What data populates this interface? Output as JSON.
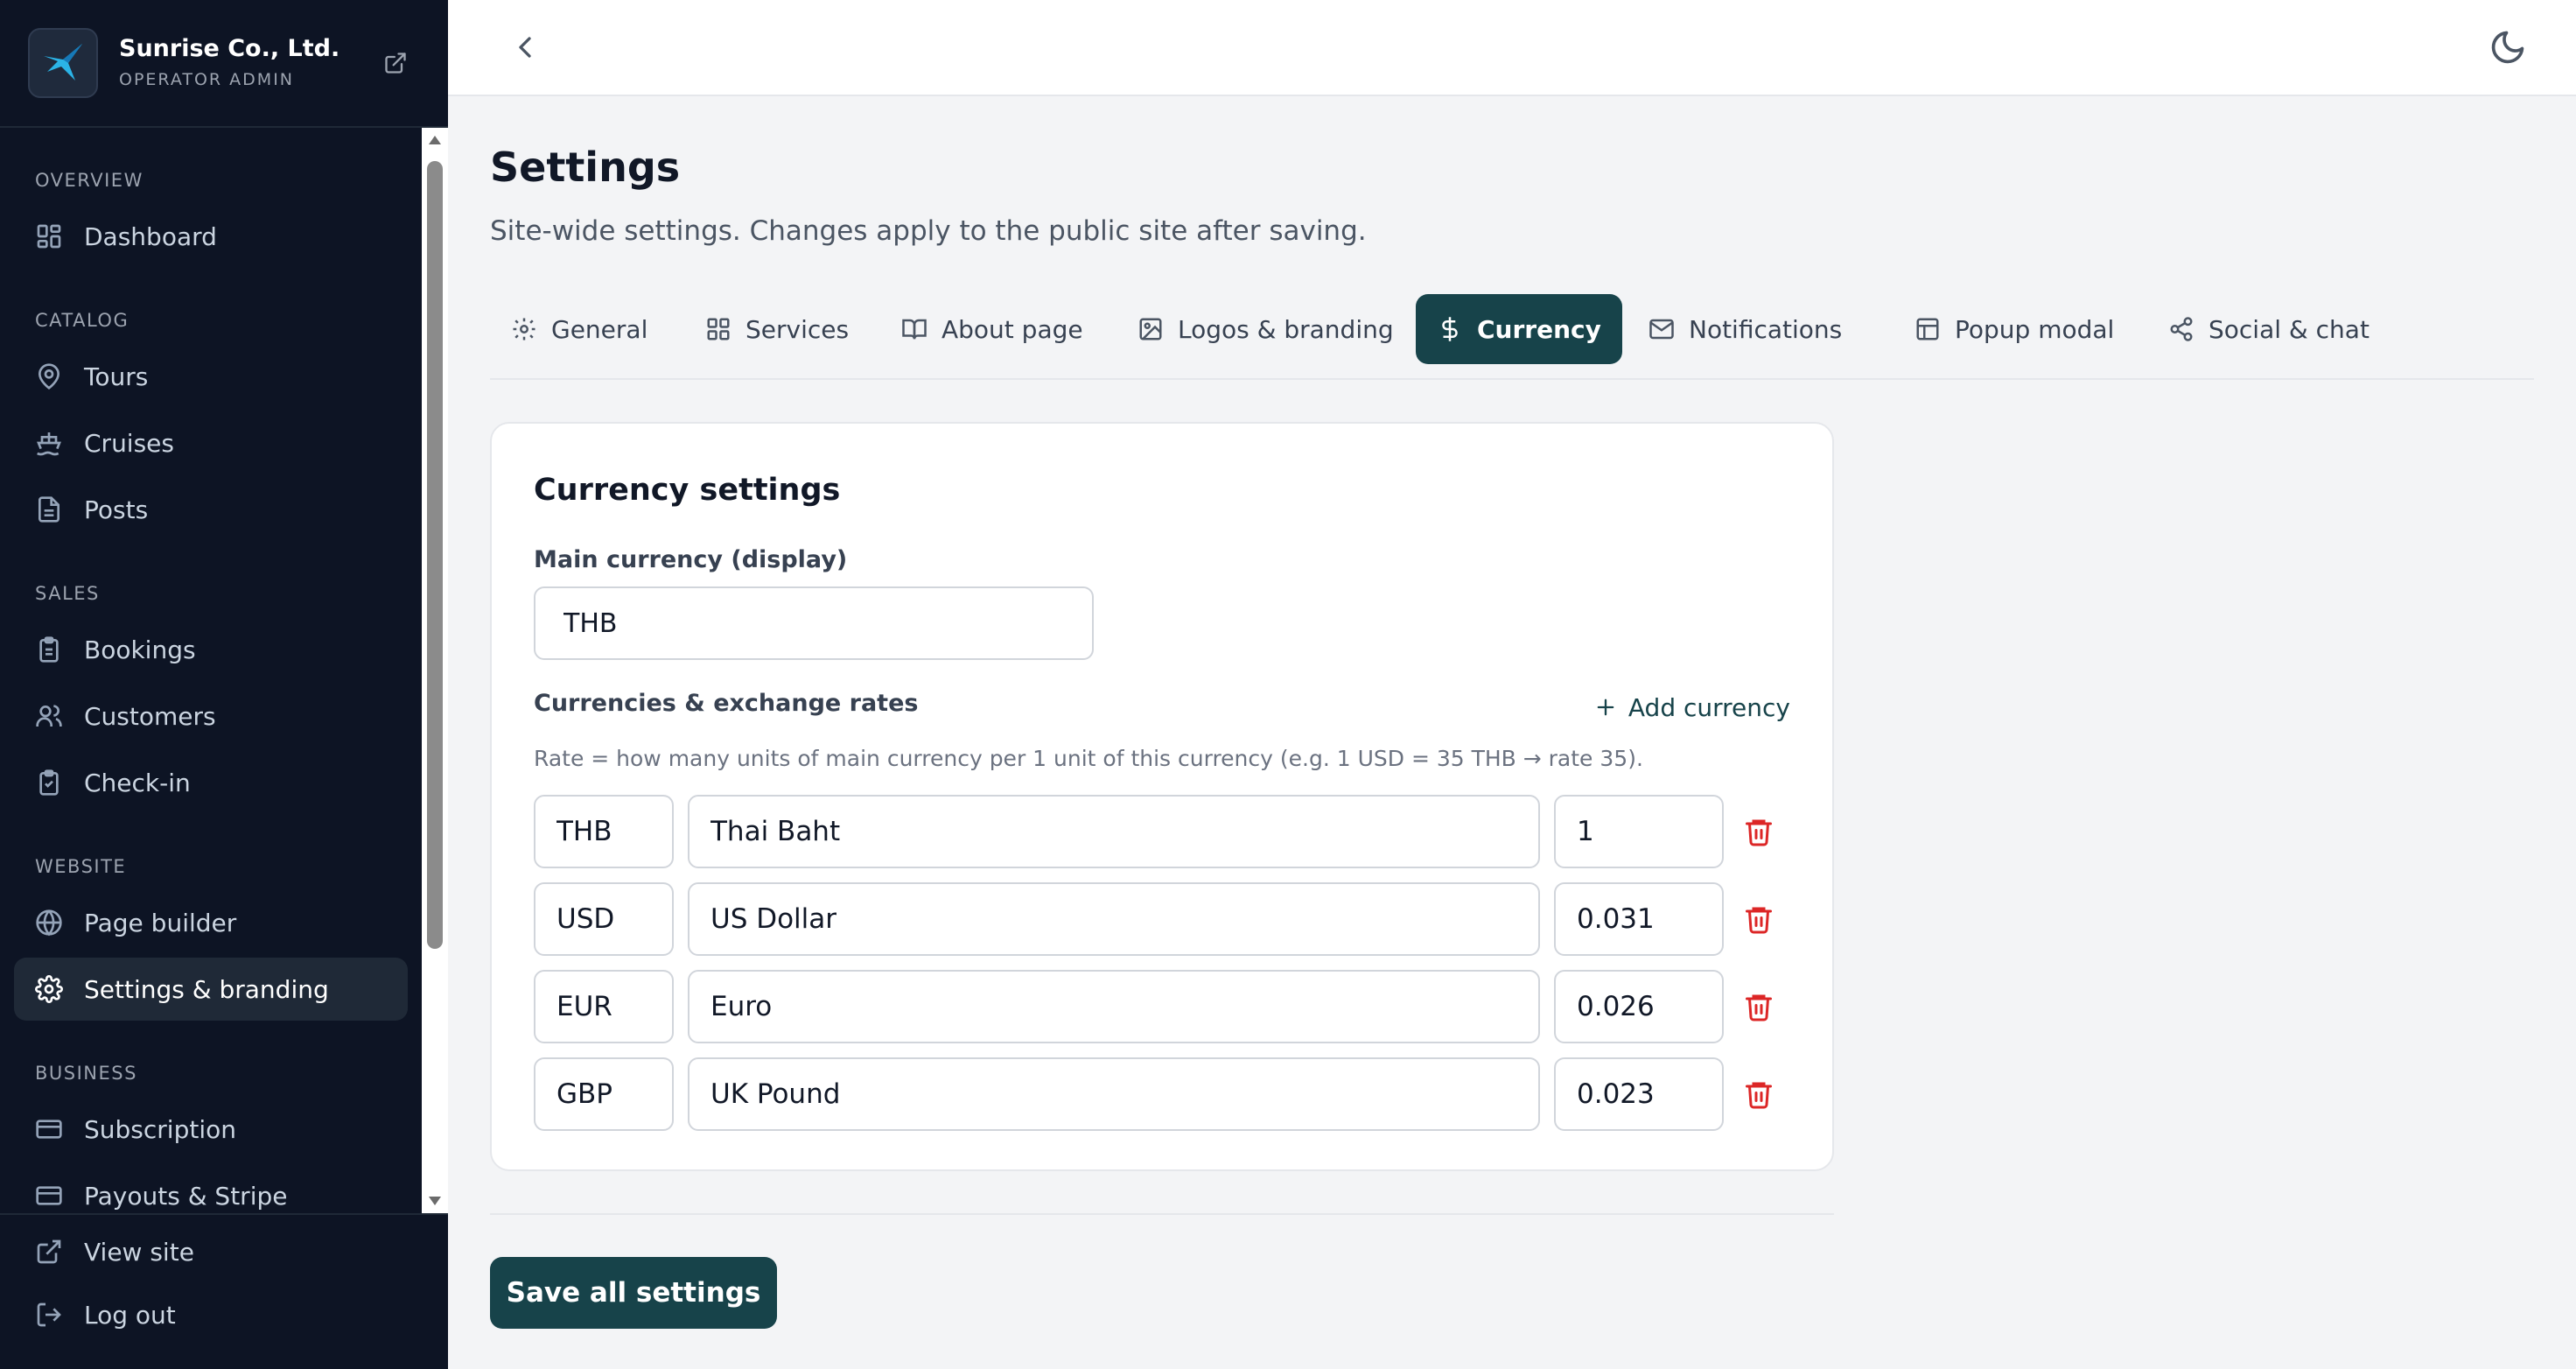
{
  "brand": {
    "name": "Sunrise Co., Ltd.",
    "role": "OPERATOR ADMIN"
  },
  "sidebar": {
    "sections": [
      {
        "title": "OVERVIEW",
        "items": [
          {
            "label": "Dashboard",
            "icon": "grid-icon"
          }
        ]
      },
      {
        "title": "CATALOG",
        "items": [
          {
            "label": "Tours",
            "icon": "map-pin-icon"
          },
          {
            "label": "Cruises",
            "icon": "ship-icon"
          },
          {
            "label": "Posts",
            "icon": "document-icon"
          }
        ]
      },
      {
        "title": "SALES",
        "items": [
          {
            "label": "Bookings",
            "icon": "clipboard-icon"
          },
          {
            "label": "Customers",
            "icon": "users-icon"
          },
          {
            "label": "Check-in",
            "icon": "clipboard-check-icon"
          }
        ]
      },
      {
        "title": "WEBSITE",
        "items": [
          {
            "label": "Page builder",
            "icon": "globe-icon"
          },
          {
            "label": "Settings & branding",
            "icon": "gear-icon",
            "active": true
          }
        ]
      },
      {
        "title": "BUSINESS",
        "items": [
          {
            "label": "Subscription",
            "icon": "credit-card-icon"
          },
          {
            "label": "Payouts & Stripe",
            "icon": "credit-card-icon"
          }
        ]
      }
    ],
    "footer": [
      {
        "label": "View site",
        "icon": "external-link-icon"
      },
      {
        "label": "Log out",
        "icon": "log-out-icon"
      }
    ]
  },
  "page": {
    "title": "Settings",
    "subtitle": "Site-wide settings. Changes apply to the public site after saving."
  },
  "tabs": [
    {
      "label": "General",
      "icon": "gear-icon"
    },
    {
      "label": "Services",
      "icon": "grid-icon"
    },
    {
      "label": "About page",
      "icon": "book-icon"
    },
    {
      "label": "Logos & branding",
      "icon": "image-icon"
    },
    {
      "label": "Currency",
      "icon": "dollar-icon",
      "active": true
    },
    {
      "label": "Notifications",
      "icon": "mail-icon"
    },
    {
      "label": "Popup modal",
      "icon": "layout-icon"
    },
    {
      "label": "Social & chat",
      "icon": "share-icon"
    }
  ],
  "currency": {
    "card_title": "Currency settings",
    "main_label": "Main currency (display)",
    "main_value": "THB",
    "rates_label": "Currencies & exchange rates",
    "add_label": "Add currency",
    "hint": "Rate = how many units of main currency per 1 unit of this currency (e.g. 1 USD = 35 THB → rate 35).",
    "rows": [
      {
        "code": "THB",
        "name": "Thai Baht",
        "rate": "1"
      },
      {
        "code": "USD",
        "name": "US Dollar",
        "rate": "0.031"
      },
      {
        "code": "EUR",
        "name": "Euro",
        "rate": "0.026"
      },
      {
        "code": "GBP",
        "name": "UK Pound",
        "rate": "0.023"
      }
    ]
  },
  "actions": {
    "save_label": "Save all settings"
  },
  "colors": {
    "sidebar_bg": "#0d1424",
    "accent": "#17434a",
    "danger": "#dc2626"
  }
}
